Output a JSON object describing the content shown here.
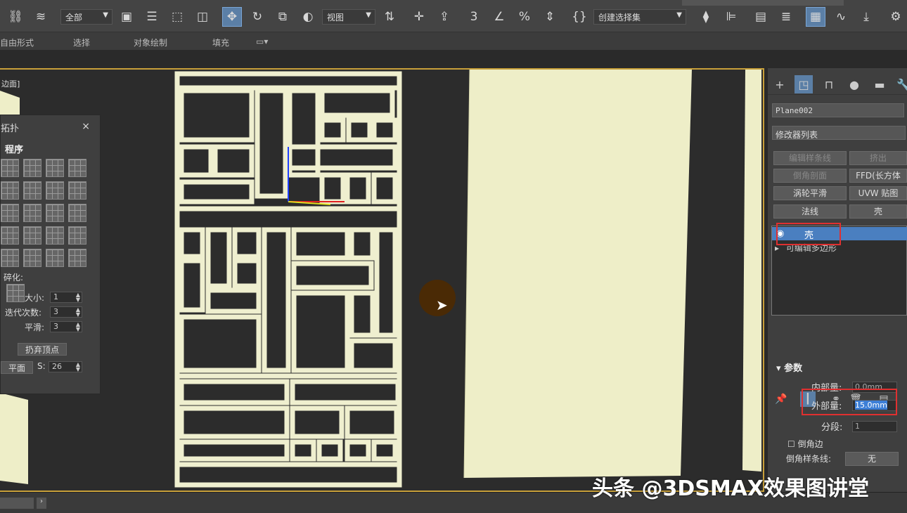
{
  "toolbar": {
    "select_filter": "全部",
    "view_select": "视图",
    "selection_set": "创建选择集"
  },
  "ribbon": {
    "items": [
      "自由形式",
      "选择",
      "对象绘制",
      "填充"
    ]
  },
  "viewport": {
    "label": "边面]"
  },
  "floating_panel": {
    "title": "拓扑",
    "close": "×",
    "section": "程序",
    "tessellate_label": "碎化:",
    "size_label": "大小:",
    "size_value": "1",
    "iterations_label": "迭代次数:",
    "iterations_value": "3",
    "smooth_label": "平滑:",
    "smooth_value": "3",
    "discard_vertices": "扔弃顶点",
    "plane_label": "平面",
    "s_label": "S:",
    "s_value": "26"
  },
  "command_panel": {
    "object_name": "Plane002",
    "modifier_list": "修改器列表",
    "buttons": [
      "编辑样条线",
      "挤出",
      "倒角剖面",
      "FFD(长方体",
      "涡轮平滑",
      "UVW 贴图",
      "法线",
      "壳"
    ],
    "stack": [
      "壳",
      "可编辑多边形"
    ],
    "params_section": "参数",
    "inner_label": "内部量:",
    "inner_value": "0.0mm",
    "outer_label": "外部量:",
    "outer_value": "15.0mm",
    "segments_label": "分段:",
    "segments_value": "1",
    "bevel_edge_label": "倒角边",
    "bevel_spline_label": "倒角样条线:",
    "bevel_spline_value": "无"
  },
  "watermark": "头条 @3DSMAX效果图讲堂",
  "colors": {
    "accent": "#4a7fc0",
    "highlight_box": "#e03030",
    "viewport_border": "#c8a03a",
    "cream": "#f0f0c8"
  }
}
